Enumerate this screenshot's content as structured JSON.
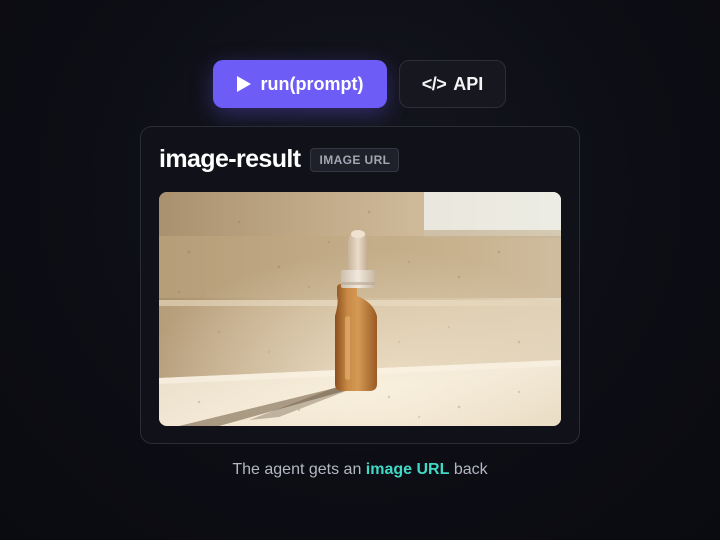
{
  "toolbar": {
    "run_label": "run(prompt)",
    "run_icon": "play-icon",
    "api_label": "API",
    "api_icon_glyph": "</>",
    "api_icon": "code-icon"
  },
  "card": {
    "title": "image-result",
    "badge": "IMAGE URL",
    "image": {
      "alt": "Amber glass dropper bottle on a sunlit stone ledge"
    }
  },
  "caption": {
    "prefix": "The agent gets an ",
    "highlight": "image URL",
    "suffix": " back"
  },
  "colors": {
    "background": "#0d0e15",
    "accent": "#6d5cf6",
    "highlight": "#40d9c6",
    "card_bg": "#111219"
  }
}
